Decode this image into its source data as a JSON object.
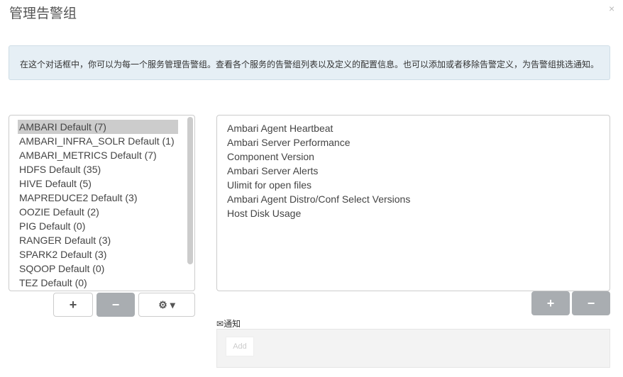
{
  "title": "管理告警组",
  "close": "×",
  "info": "在这个对话框中，你可以为每一个服务管理告警组。查看各个服务的告警组列表以及定义的配置信息。也可以添加或者移除告警定义，为告警组挑选通知。",
  "groups": [
    "AMBARI Default (7)",
    "AMBARI_INFRA_SOLR Default (1)",
    "AMBARI_METRICS Default (7)",
    "HDFS Default (35)",
    "HIVE Default (5)",
    "MAPREDUCE2 Default (3)",
    "OOZIE Default (2)",
    "PIG Default (0)",
    "RANGER Default (3)",
    "SPARK2 Default (3)",
    "SQOOP Default (0)",
    "TEZ Default (0)"
  ],
  "definitions": [
    "Ambari Agent Heartbeat",
    "Ambari Server Performance",
    "Component Version",
    "Ambari Server Alerts",
    "Ulimit for open files",
    "Ambari Agent Distro/Conf Select Versions",
    "Host Disk Usage"
  ],
  "buttons": {
    "plus": "+",
    "minus": "−",
    "gear": "⚙ ▾"
  },
  "notifications": {
    "label": "通知",
    "icon": "✉",
    "add": "Add"
  }
}
